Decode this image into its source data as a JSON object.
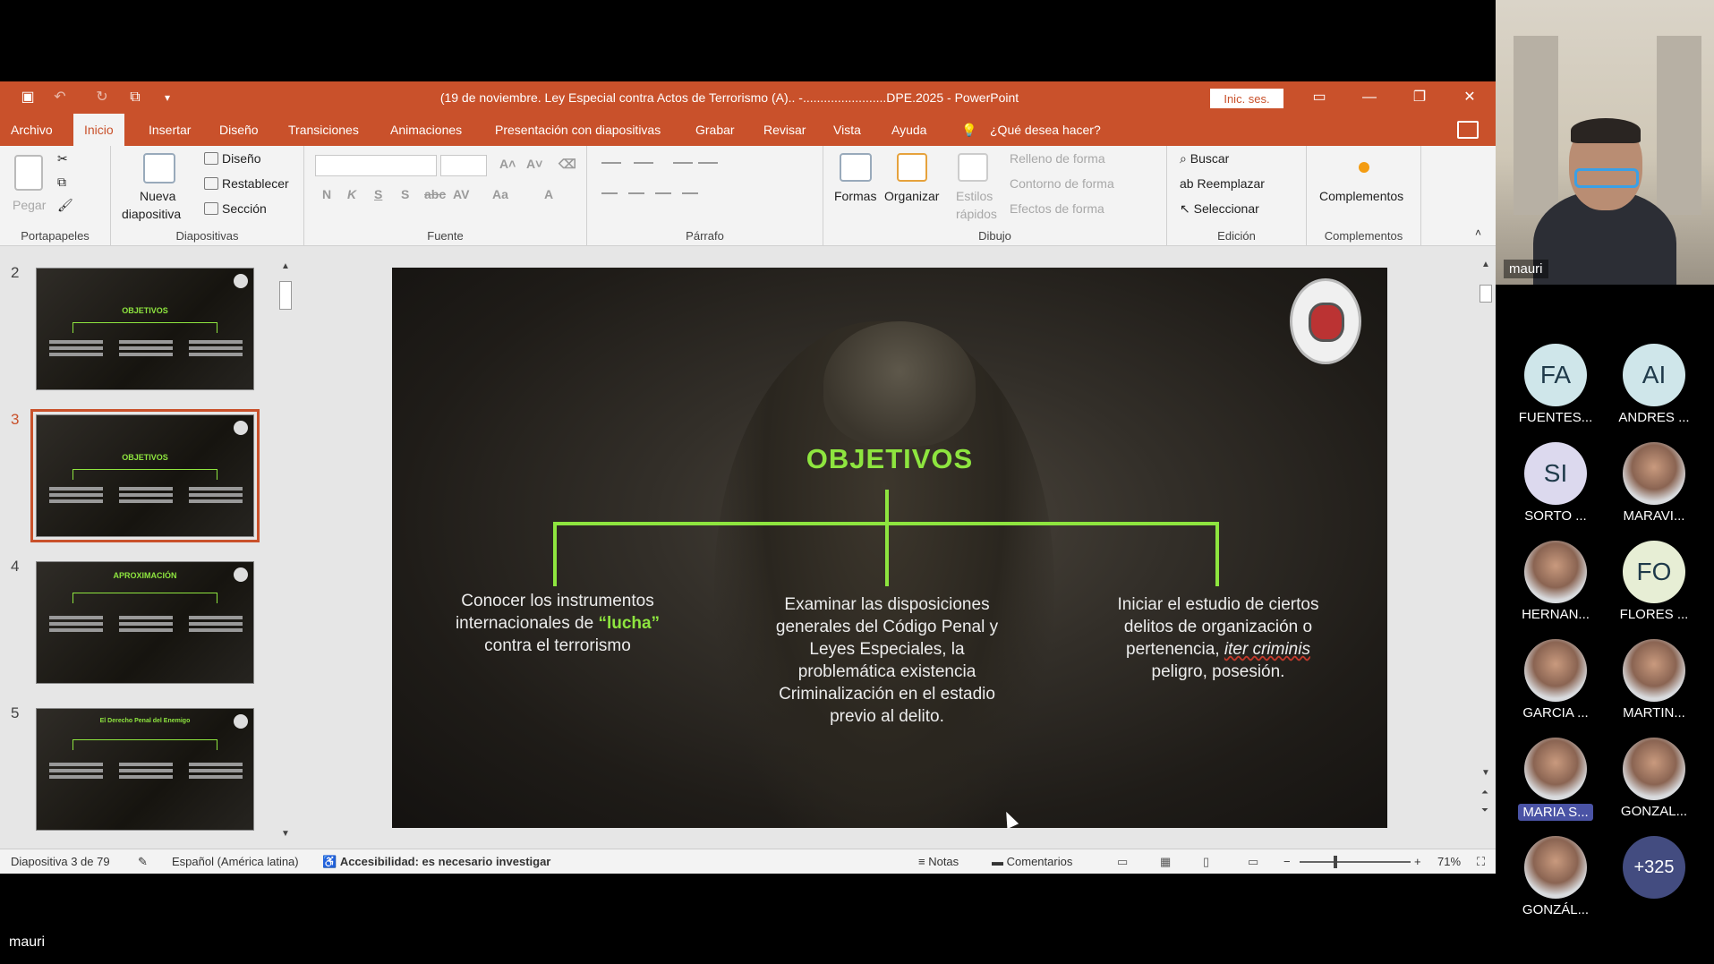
{
  "window": {
    "title": "(19 de noviembre. Ley Especial contra Actos de Terrorismo (A).. -........................DPE.2025  -  PowerPoint",
    "signin": "Inic. ses."
  },
  "tabs": [
    "Archivo",
    "Inicio",
    "Insertar",
    "Diseño",
    "Transiciones",
    "Animaciones",
    "Presentación con diapositivas",
    "Grabar",
    "Revisar",
    "Vista",
    "Ayuda"
  ],
  "tellme": "¿Qué desea hacer?",
  "ribbon": {
    "portapapeles": {
      "label": "Portapapeles",
      "pegar": "Pegar"
    },
    "diapositivas": {
      "label": "Diapositivas",
      "nueva": "Nueva",
      "diapositiva": "diapositiva",
      "diseno": "Diseño",
      "restablecer": "Restablecer",
      "seccion": "Sección"
    },
    "fuente": {
      "label": "Fuente",
      "n": "N",
      "k": "K",
      "s": "S",
      "s2": "S",
      "abc": "abc",
      "av": "AV",
      "aa": "Aa",
      "a": "A"
    },
    "parrafo": {
      "label": "Párrafo"
    },
    "dibujo": {
      "label": "Dibujo",
      "formas": "Formas",
      "organizar": "Organizar",
      "estilos": "Estilos",
      "rapidos": "rápidos",
      "relleno": "Relleno de forma",
      "contorno": "Contorno de forma",
      "efectos": "Efectos de forma"
    },
    "edicion": {
      "label": "Edición",
      "buscar": "Buscar",
      "reemplazar": "Reemplazar",
      "seleccionar": "Seleccionar"
    },
    "complementos": {
      "label": "Complementos",
      "btn": "Complementos"
    }
  },
  "thumbs": [
    {
      "num": "2",
      "title": "OBJETIVOS"
    },
    {
      "num": "3",
      "title": "OBJETIVOS"
    },
    {
      "num": "4",
      "title": "APROXIMACIÓN"
    },
    {
      "num": "5",
      "title": "El Derecho Penal del Enemigo"
    }
  ],
  "slide": {
    "title": "OBJETIVOS",
    "col1_a": "Conocer los instrumentos internacionales de ",
    "col1_hl": "“lucha”",
    "col1_b": " contra el terrorismo",
    "col2": "Examinar las disposiciones generales del Código Penal y Leyes Especiales, la problemática existencia Criminalización en el estadio previo al delito.",
    "col3_a": "Iniciar el estudio de ciertos delitos de organización o pertenencia, ",
    "col3_it": "iter criminis",
    "col3_b": " peligro, posesión."
  },
  "status": {
    "slide": "Diapositiva 3 de 79",
    "lang": "Español (América latina)",
    "access": "Accesibilidad: es necesario investigar",
    "notas": "Notas",
    "comentarios": "Comentarios",
    "zoom": "71%"
  },
  "camera": {
    "name": "mauri"
  },
  "participants": [
    {
      "initials": "FA",
      "name": "FUENTES..."
    },
    {
      "initials": "AI",
      "name": "ANDRES ..."
    },
    {
      "initials": "SI",
      "name": "SORTO ..."
    },
    {
      "initials": "",
      "name": "MARAVI..."
    },
    {
      "initials": "",
      "name": "HERNAN..."
    },
    {
      "initials": "FO",
      "name": "FLORES ..."
    },
    {
      "initials": "",
      "name": "GARCIA ..."
    },
    {
      "initials": "",
      "name": "MARTIN..."
    },
    {
      "initials": "",
      "name": "MARIA S..."
    },
    {
      "initials": "",
      "name": "GONZAL..."
    },
    {
      "initials": "",
      "name": "GONZÁL..."
    },
    {
      "initials": "+325",
      "name": ""
    }
  ],
  "presenter": "mauri"
}
